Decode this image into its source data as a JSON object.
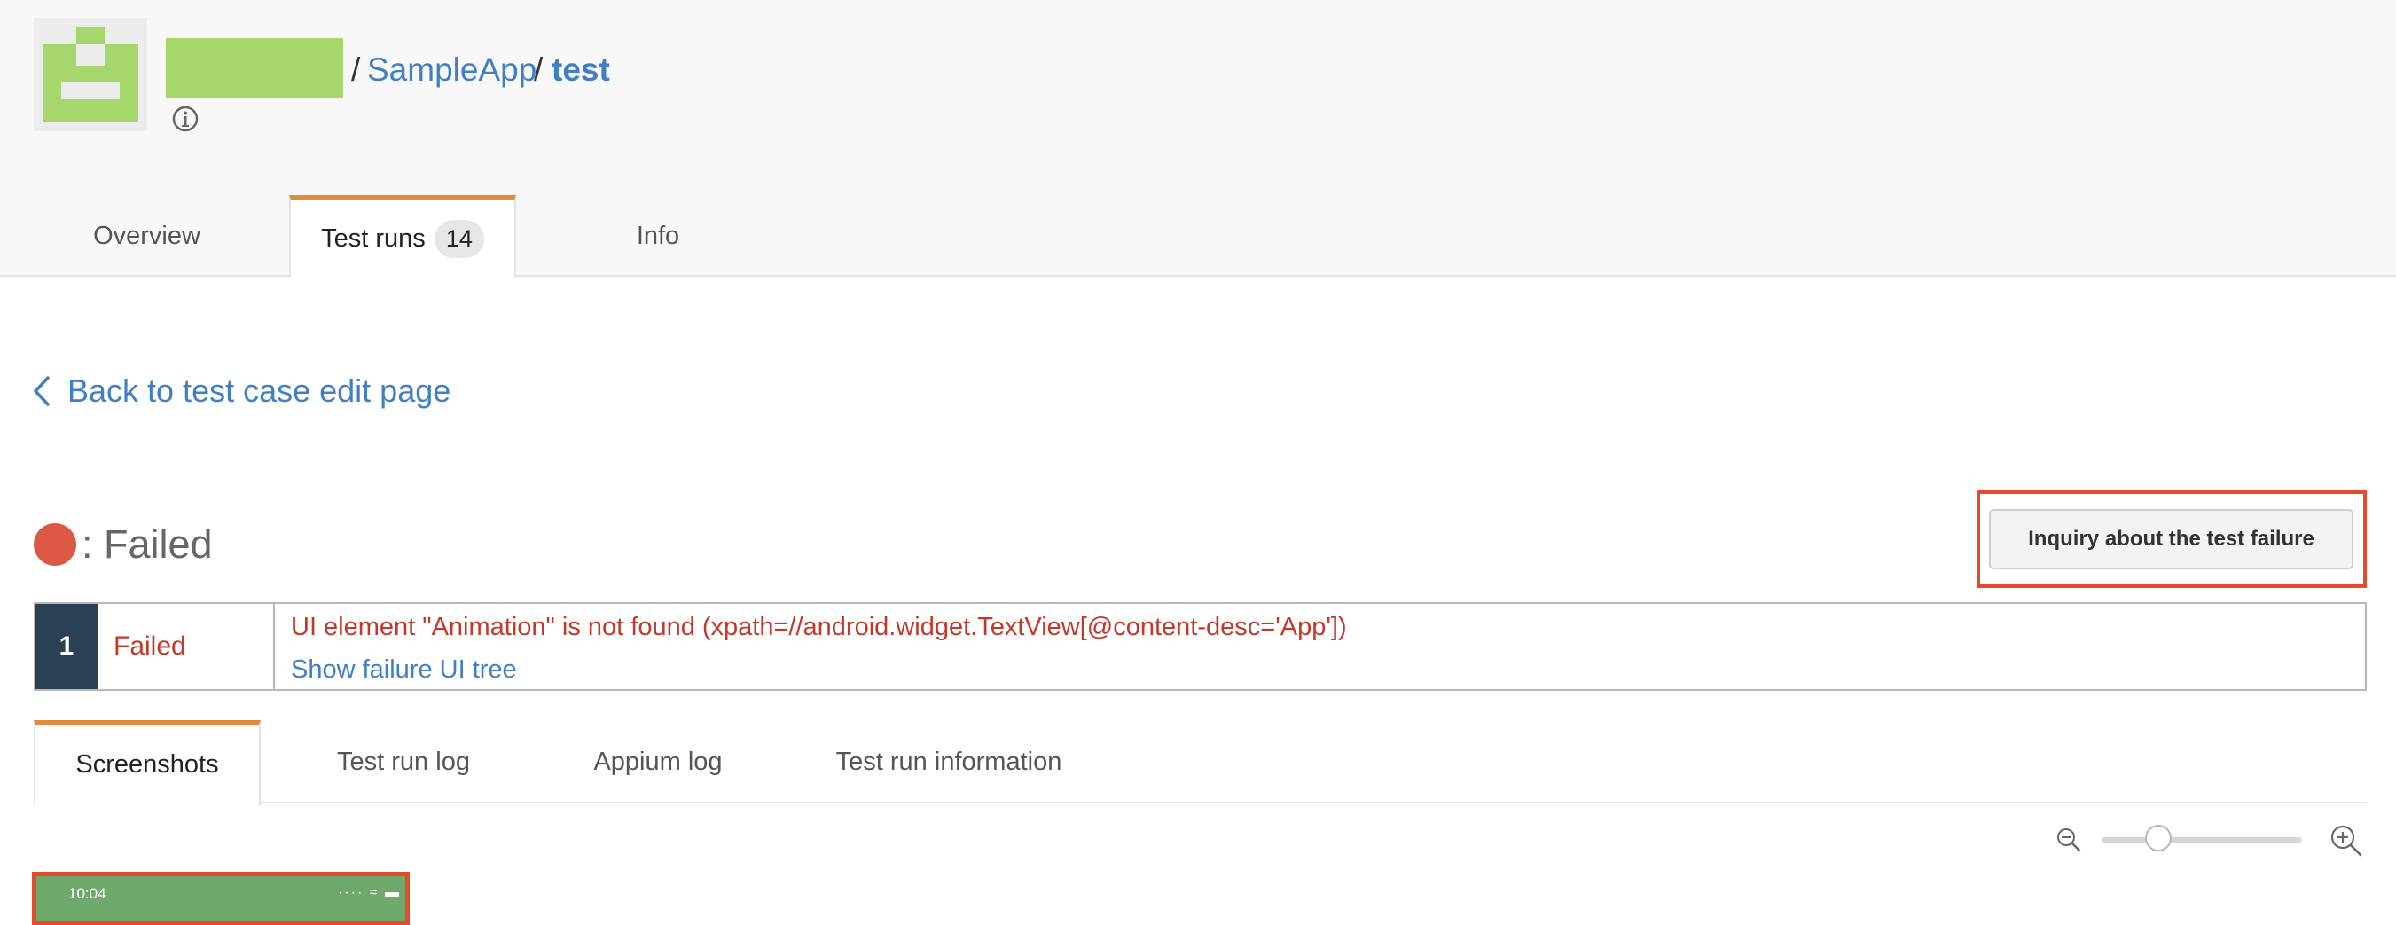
{
  "header": {
    "breadcrumb": {
      "separator": "/",
      "app": "SampleApp",
      "test": "test"
    },
    "icons": {
      "app_icon": "pixel-robot-icon",
      "info": "info-circle-icon"
    },
    "colors": {
      "app_icon_green": "#a6d66c",
      "link_blue": "#3f7fc2",
      "tab_accent": "#e08a3c"
    }
  },
  "tabs": [
    {
      "label": "Overview",
      "active": false
    },
    {
      "label": "Test runs",
      "badge": "14",
      "active": true
    },
    {
      "label": "Info",
      "active": false
    }
  ],
  "back_link": {
    "label": "Back to test case edit page",
    "icon": "chevron-left-icon"
  },
  "status": {
    "label": ": Failed",
    "color": "#dc5846"
  },
  "inquiry_button": {
    "label": "Inquiry about the test failure"
  },
  "failure": {
    "step": "1",
    "status": "Failed",
    "message": "UI element \"Animation\" is not found (xpath=//android.widget.TextView[@content-desc='App'])",
    "link": "Show failure UI tree"
  },
  "subtabs": [
    {
      "label": "Screenshots",
      "active": true
    },
    {
      "label": "Test run log",
      "active": false
    },
    {
      "label": "Appium log",
      "active": false
    },
    {
      "label": "Test run information",
      "active": false
    }
  ],
  "zoom": {
    "level": 0.25,
    "icons": [
      "zoom-out-icon",
      "zoom-in-icon"
    ]
  },
  "screenshot_thumb": {
    "time": "10:04",
    "status_icons": "····  ≈ ▬"
  }
}
